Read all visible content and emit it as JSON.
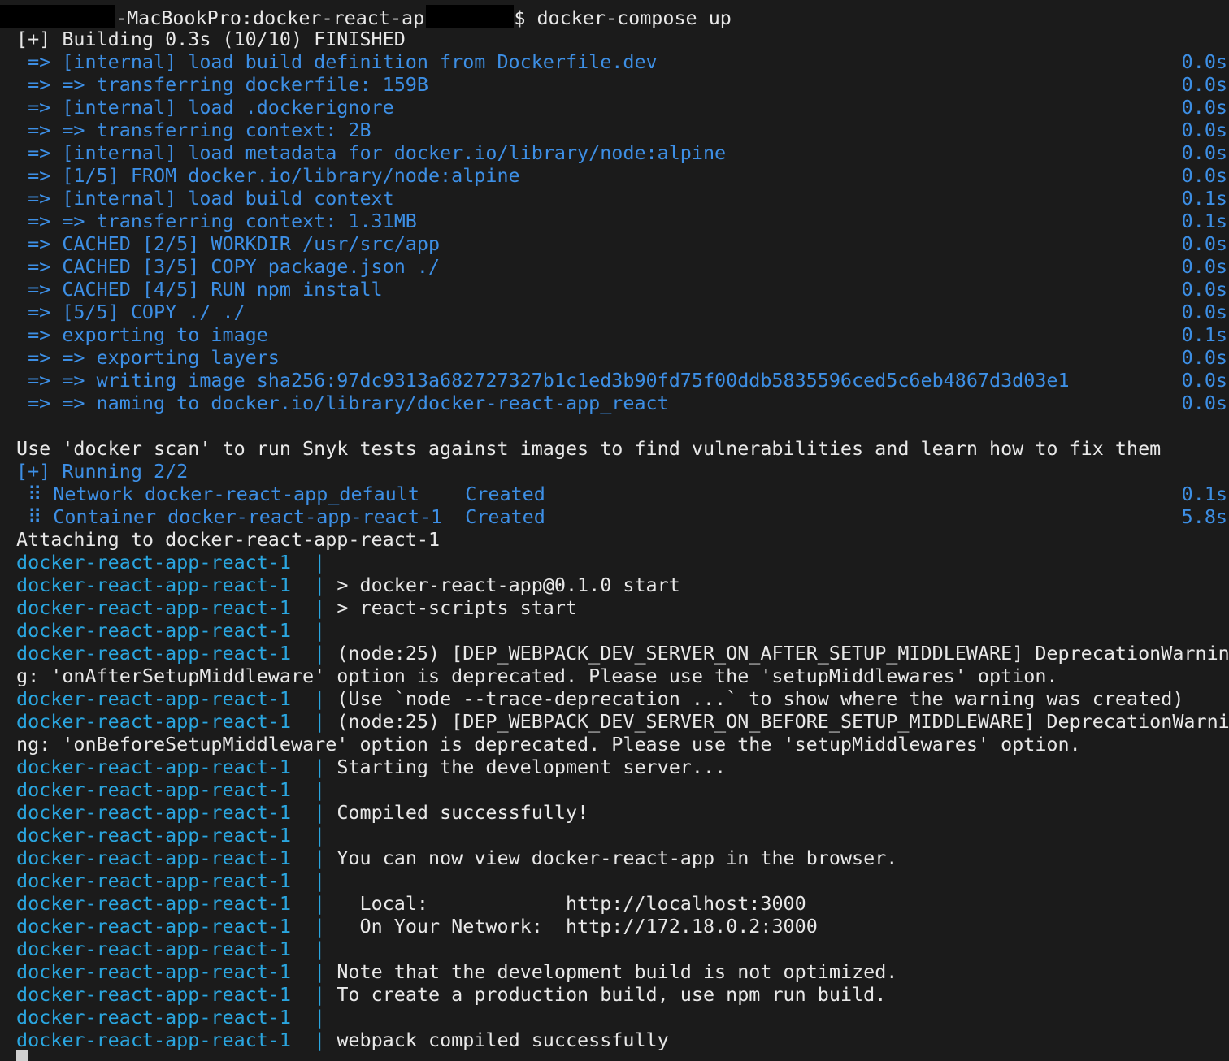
{
  "colors": {
    "background": "#1b1b1b",
    "text": "#e8e8e8",
    "blue": "#3d8fe5",
    "cyan": "#2aa6e0",
    "redaction": "#000000",
    "cursor": "#d0d0d0"
  },
  "lines": [
    {
      "kind": "prompt",
      "host_suffix": "-MacBookPro:docker-react-app",
      "command": "$ docker-compose up"
    },
    {
      "kind": "plain",
      "segments": [
        {
          "text": "[+] Building 0.3s (10/10) FINISHED",
          "color": "text"
        }
      ]
    },
    {
      "kind": "build",
      "text": " => [internal] load build definition from Dockerfile.dev",
      "time": "0.0s"
    },
    {
      "kind": "build",
      "text": " => => transferring dockerfile: 159B",
      "time": "0.0s"
    },
    {
      "kind": "build",
      "text": " => [internal] load .dockerignore",
      "time": "0.0s"
    },
    {
      "kind": "build",
      "text": " => => transferring context: 2B",
      "time": "0.0s"
    },
    {
      "kind": "build",
      "text": " => [internal] load metadata for docker.io/library/node:alpine",
      "time": "0.0s"
    },
    {
      "kind": "build",
      "text": " => [1/5] FROM docker.io/library/node:alpine",
      "time": "0.0s"
    },
    {
      "kind": "build",
      "text": " => [internal] load build context",
      "time": "0.1s"
    },
    {
      "kind": "build",
      "text": " => => transferring context: 1.31MB",
      "time": "0.1s"
    },
    {
      "kind": "build",
      "text": " => CACHED [2/5] WORKDIR /usr/src/app",
      "time": "0.0s"
    },
    {
      "kind": "build",
      "text": " => CACHED [3/5] COPY package.json ./",
      "time": "0.0s"
    },
    {
      "kind": "build",
      "text": " => CACHED [4/5] RUN npm install",
      "time": "0.0s"
    },
    {
      "kind": "build",
      "text": " => [5/5] COPY ./ ./",
      "time": "0.0s"
    },
    {
      "kind": "build",
      "text": " => exporting to image",
      "time": "0.1s"
    },
    {
      "kind": "build",
      "text": " => => exporting layers",
      "time": "0.0s"
    },
    {
      "kind": "build",
      "text": " => => writing image sha256:97dc9313a682727327b1c1ed3b90fd75f00ddb5835596ced5c6eb4867d3d03e1",
      "time": "0.0s"
    },
    {
      "kind": "build",
      "text": " => => naming to docker.io/library/docker-react-app_react",
      "time": "0.0s"
    },
    {
      "kind": "plain",
      "segments": [
        {
          "text": "",
          "color": "text"
        }
      ]
    },
    {
      "kind": "plain",
      "segments": [
        {
          "text": "Use 'docker scan' to run Snyk tests against images to find vulnerabilities and learn how to fix them",
          "color": "text"
        }
      ]
    },
    {
      "kind": "plain",
      "segments": [
        {
          "text": "[+] Running 2/2",
          "color": "blue"
        }
      ]
    },
    {
      "kind": "build",
      "text": " ⠿ Network docker-react-app_default    Created",
      "time": "0.1s"
    },
    {
      "kind": "build",
      "text": " ⠿ Container docker-react-app-react-1  Created",
      "time": "5.8s"
    },
    {
      "kind": "plain",
      "segments": [
        {
          "text": "Attaching to docker-react-app-react-1",
          "color": "text"
        }
      ]
    },
    {
      "kind": "log",
      "text": ""
    },
    {
      "kind": "log",
      "text": "> docker-react-app@0.1.0 start"
    },
    {
      "kind": "log",
      "text": "> react-scripts start"
    },
    {
      "kind": "log",
      "text": ""
    },
    {
      "kind": "log",
      "text": "(node:25) [DEP_WEBPACK_DEV_SERVER_ON_AFTER_SETUP_MIDDLEWARE] DeprecationWarnin"
    },
    {
      "kind": "plain",
      "segments": [
        {
          "text": "g: 'onAfterSetupMiddleware' option is deprecated. Please use the 'setupMiddlewares' option.",
          "color": "text"
        }
      ]
    },
    {
      "kind": "log",
      "text": "(Use `node --trace-deprecation ...` to show where the warning was created)"
    },
    {
      "kind": "log",
      "text": "(node:25) [DEP_WEBPACK_DEV_SERVER_ON_BEFORE_SETUP_MIDDLEWARE] DeprecationWarni"
    },
    {
      "kind": "plain",
      "segments": [
        {
          "text": "ng: 'onBeforeSetupMiddleware' option is deprecated. Please use the 'setupMiddlewares' option.",
          "color": "text"
        }
      ]
    },
    {
      "kind": "log",
      "text": "Starting the development server..."
    },
    {
      "kind": "log",
      "text": ""
    },
    {
      "kind": "log",
      "text": "Compiled successfully!"
    },
    {
      "kind": "log",
      "text": ""
    },
    {
      "kind": "log",
      "text": "You can now view docker-react-app in the browser."
    },
    {
      "kind": "log",
      "text": ""
    },
    {
      "kind": "log",
      "text": "  Local:            http://localhost:3000"
    },
    {
      "kind": "log",
      "text": "  On Your Network:  http://172.18.0.2:3000"
    },
    {
      "kind": "log",
      "text": ""
    },
    {
      "kind": "log",
      "text": "Note that the development build is not optimized."
    },
    {
      "kind": "log",
      "text": "To create a production build, use npm run build."
    },
    {
      "kind": "log",
      "text": ""
    },
    {
      "kind": "log",
      "text": "webpack compiled successfully"
    }
  ],
  "log_prefix": "docker-react-app-react-1  | "
}
